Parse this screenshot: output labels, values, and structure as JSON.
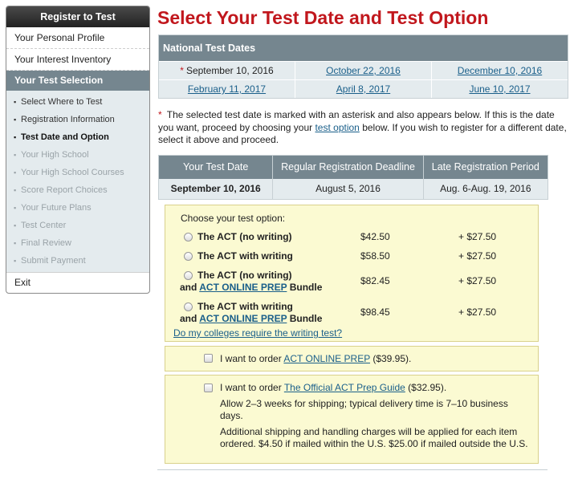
{
  "sidebar": {
    "header": "Register to Test",
    "items": [
      "Your Personal Profile",
      "Your Interest Inventory"
    ],
    "active_section": "Your Test Selection",
    "subitems": [
      {
        "label": "Select Where to Test",
        "state": "done"
      },
      {
        "label": "Registration Information",
        "state": "done"
      },
      {
        "label": "Test Date and Option",
        "state": "current"
      },
      {
        "label": "Your High School",
        "state": "pending"
      },
      {
        "label": "Your High School Courses",
        "state": "pending"
      },
      {
        "label": "Score Report Choices",
        "state": "pending"
      },
      {
        "label": "Your Future Plans",
        "state": "pending"
      },
      {
        "label": "Test Center",
        "state": "pending"
      },
      {
        "label": "Final Review",
        "state": "pending"
      },
      {
        "label": "Submit Payment",
        "state": "pending"
      }
    ],
    "exit": "Exit"
  },
  "main": {
    "title": "Select Your Test Date and Test Option",
    "dates_header": "National Test Dates",
    "dates": [
      [
        "September 10, 2016",
        "October 22, 2016",
        "December 10, 2016"
      ],
      [
        "February 11, 2017",
        "April 8, 2017",
        "June 10, 2017"
      ]
    ],
    "note_asterisk": "*",
    "note_part1": "The selected test date is marked with an asterisk and also appears below. If this is the date you want, proceed by choosing your",
    "note_link": "test option",
    "note_part2": "below. If you wish to register for a different date, select it above and proceed.",
    "selection_headers": [
      "Your Test Date",
      "Regular Registration Deadline",
      "Late Registration Period"
    ],
    "selection_row": [
      "September 10, 2016",
      "August 5, 2016",
      "Aug. 6-Aug. 19, 2016"
    ],
    "options_label": "Choose your test option:",
    "options": [
      {
        "line1": "The ACT (no writing)",
        "price": "$42.50",
        "late": "+ $27.50"
      },
      {
        "line1": "The ACT with writing",
        "price": "$58.50",
        "late": "+ $27.50"
      },
      {
        "line1": "The ACT (no writing)",
        "line2_pre": "and",
        "line2_link": "ACT ONLINE PREP",
        "line2_post": "Bundle",
        "price": "$82.45",
        "late": "+ $27.50"
      },
      {
        "line1": "The ACT with writing",
        "line2_pre": "and",
        "line2_link": "ACT ONLINE PREP",
        "line2_post": "Bundle",
        "price": "$98.45",
        "late": "+ $27.50"
      }
    ],
    "writing_link": "Do my colleges require the writing test?",
    "addon1": {
      "pre": "I want to order",
      "link": "ACT ONLINE PREP",
      "post": "($39.95)."
    },
    "addon2": {
      "pre": "I want to order",
      "link": "The Official ACT Prep Guide",
      "post": "($32.95).",
      "p2": "Allow 2–3 weeks for shipping; typical delivery time is 7–10 business days.",
      "p3": "Additional shipping and handling charges will be applied for each item ordered. $4.50 if mailed within the U.S. $25.00 if mailed outside the U.S."
    }
  }
}
